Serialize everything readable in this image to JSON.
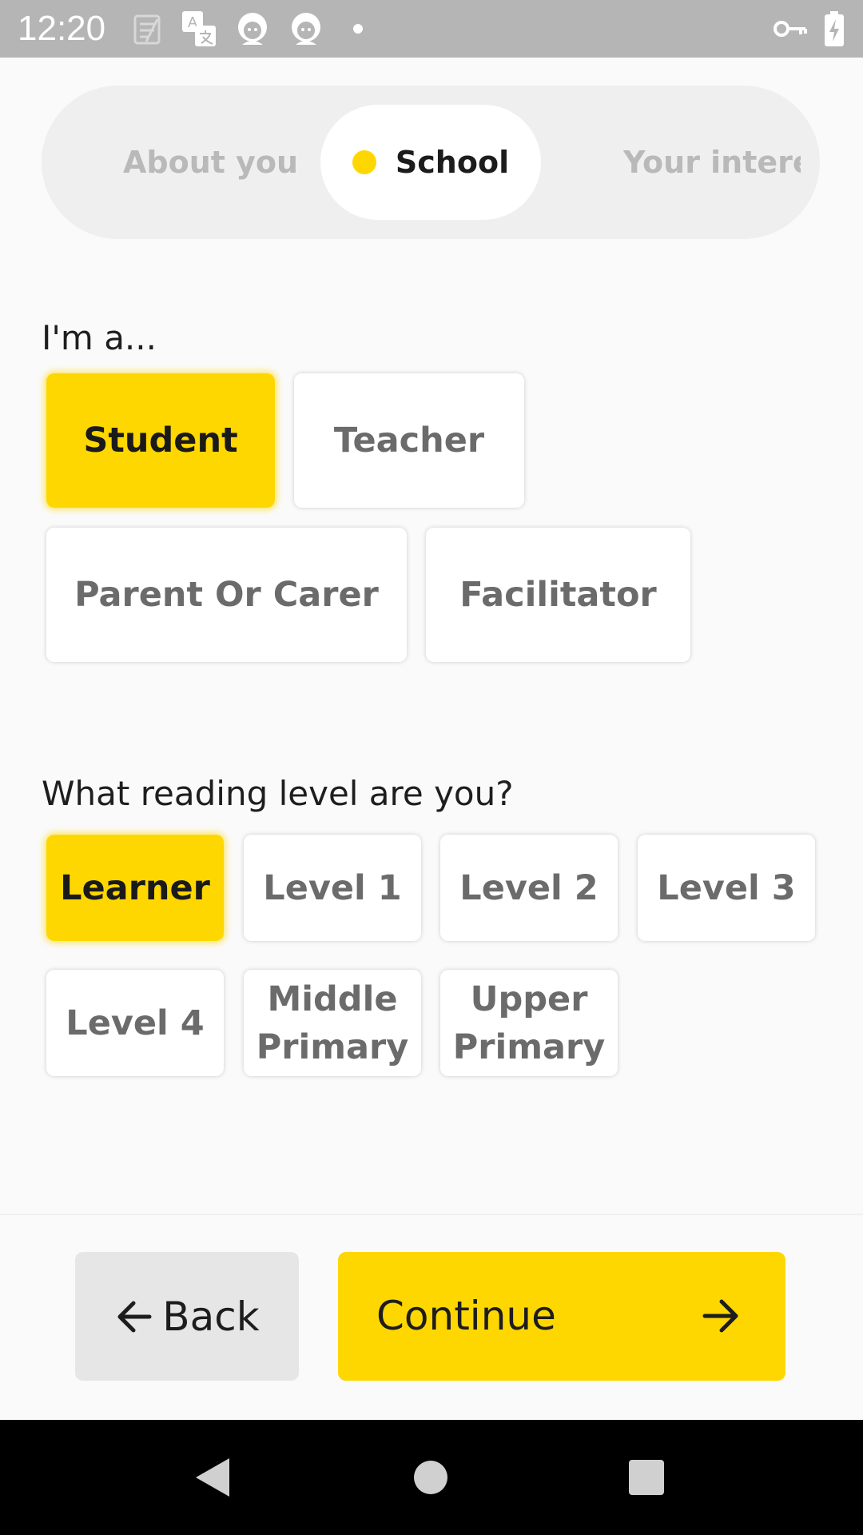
{
  "status_bar": {
    "time": "12:20",
    "left_icons": [
      "notes-icon",
      "translate-icon",
      "avatar-icon",
      "avatar-icon"
    ],
    "right_icons": [
      "vpn-key-icon",
      "battery-charging-icon"
    ]
  },
  "stepper": {
    "steps": [
      {
        "label": "About you",
        "state": "inactive"
      },
      {
        "label": "School",
        "state": "active"
      },
      {
        "label": "Your interests",
        "state": "inactive"
      }
    ],
    "accent_color": "#fed700"
  },
  "role_section": {
    "heading": "I'm a...",
    "options": [
      {
        "label": "Student",
        "selected": true
      },
      {
        "label": "Teacher",
        "selected": false
      },
      {
        "label": "Parent Or Carer",
        "selected": false
      },
      {
        "label": "Facilitator",
        "selected": false
      }
    ]
  },
  "level_section": {
    "heading": "What reading level are you?",
    "options": [
      {
        "label": "Learner",
        "selected": true
      },
      {
        "label": "Level 1",
        "selected": false
      },
      {
        "label": "Level 2",
        "selected": false
      },
      {
        "label": "Level 3",
        "selected": false
      },
      {
        "label": "Level 4",
        "selected": false
      },
      {
        "label": "Middle Primary",
        "lines": [
          "Middle",
          "Primary"
        ],
        "selected": false
      },
      {
        "label": "Upper Primary",
        "lines": [
          "Upper",
          "Primary"
        ],
        "selected": false
      }
    ]
  },
  "actions": {
    "back_label": "Back",
    "continue_label": "Continue"
  },
  "nav_bar": {
    "buttons": [
      "back-triangle-icon",
      "home-circle-icon",
      "recents-square-icon"
    ]
  },
  "colors": {
    "accent": "#fed700",
    "status_bar": "#b5b5b5",
    "background": "#fafafa"
  }
}
